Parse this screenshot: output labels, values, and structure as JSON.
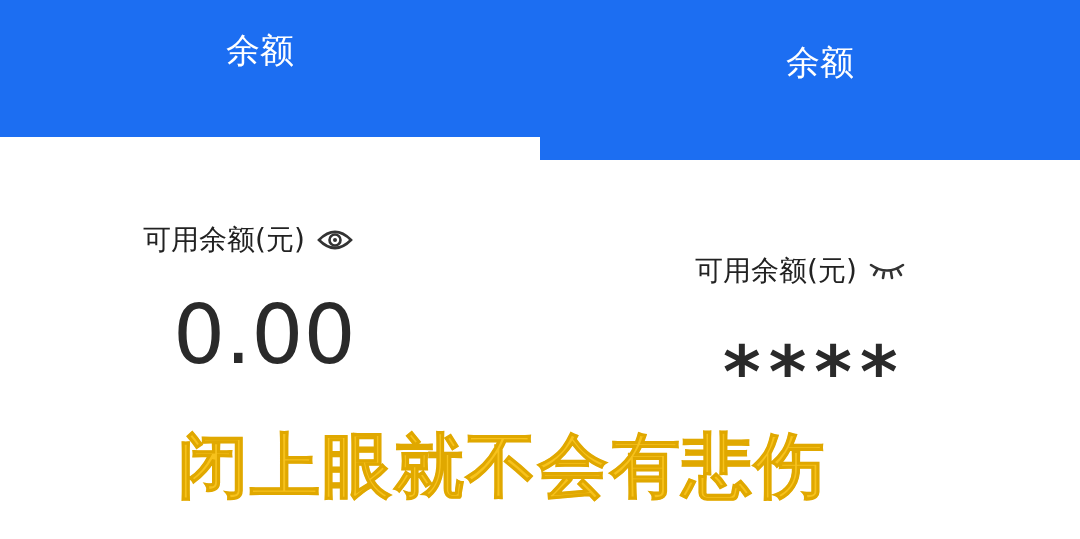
{
  "panels": [
    {
      "title": "余额",
      "label": "可用余额(元)",
      "balance_visible": true,
      "amount": "0.00"
    },
    {
      "title": "余额",
      "label": "可用余额(元)",
      "balance_visible": false,
      "amount": "****"
    }
  ],
  "caption": "闭上眼就不会有悲伤"
}
